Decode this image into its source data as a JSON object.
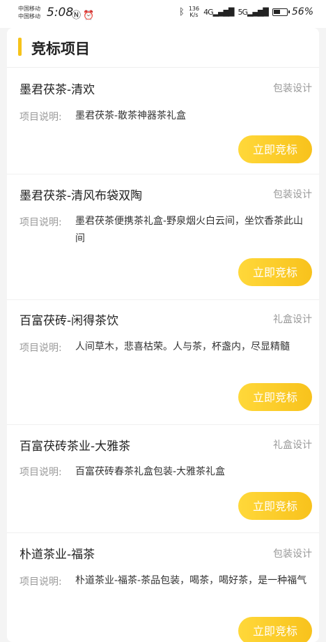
{
  "status": {
    "carrier1": "中国移动",
    "carrier2": "中国移动",
    "time": "5:08",
    "net_speed_value": "136",
    "net_speed_unit": "K/s",
    "signal1": "4G",
    "signal2": "5G",
    "battery": "56%"
  },
  "section": {
    "title": "竞标项目"
  },
  "projects": [
    {
      "title": "墨君茯茶-清欢",
      "category": "包装设计",
      "desc_label": "项目说明:",
      "desc": "墨君茯茶-散茶神器茶礼盒",
      "button": "立即竞标"
    },
    {
      "title": "墨君茯茶-清风布袋双陶",
      "category": "包装设计",
      "desc_label": "项目说明:",
      "desc": "墨君茯茶便携茶礼盒-野泉烟火白云间，坐饮香茶此山间",
      "button": "立即竞标"
    },
    {
      "title": "百富茯砖-闲得茶饮",
      "category": "礼盒设计",
      "desc_label": "项目说明:",
      "desc": "人间草木，悲喜枯荣。人与茶，杯盏内，尽显精髓",
      "button": "立即竞标"
    },
    {
      "title": "百富茯砖茶业-大雅茶",
      "category": "礼盒设计",
      "desc_label": "项目说明:",
      "desc": "百富茯砖春茶礼盒包装-大雅茶礼盒",
      "button": "立即竞标"
    },
    {
      "title": "朴道茶业-福茶",
      "category": "包装设计",
      "desc_label": "项目说明:",
      "desc": "朴道茶业-福茶-茶品包装，喝茶，喝好茶，是一种福气",
      "button": "立即竞标"
    }
  ],
  "colors": {
    "accent": "#f6c31a",
    "button": "#f8c21c"
  }
}
